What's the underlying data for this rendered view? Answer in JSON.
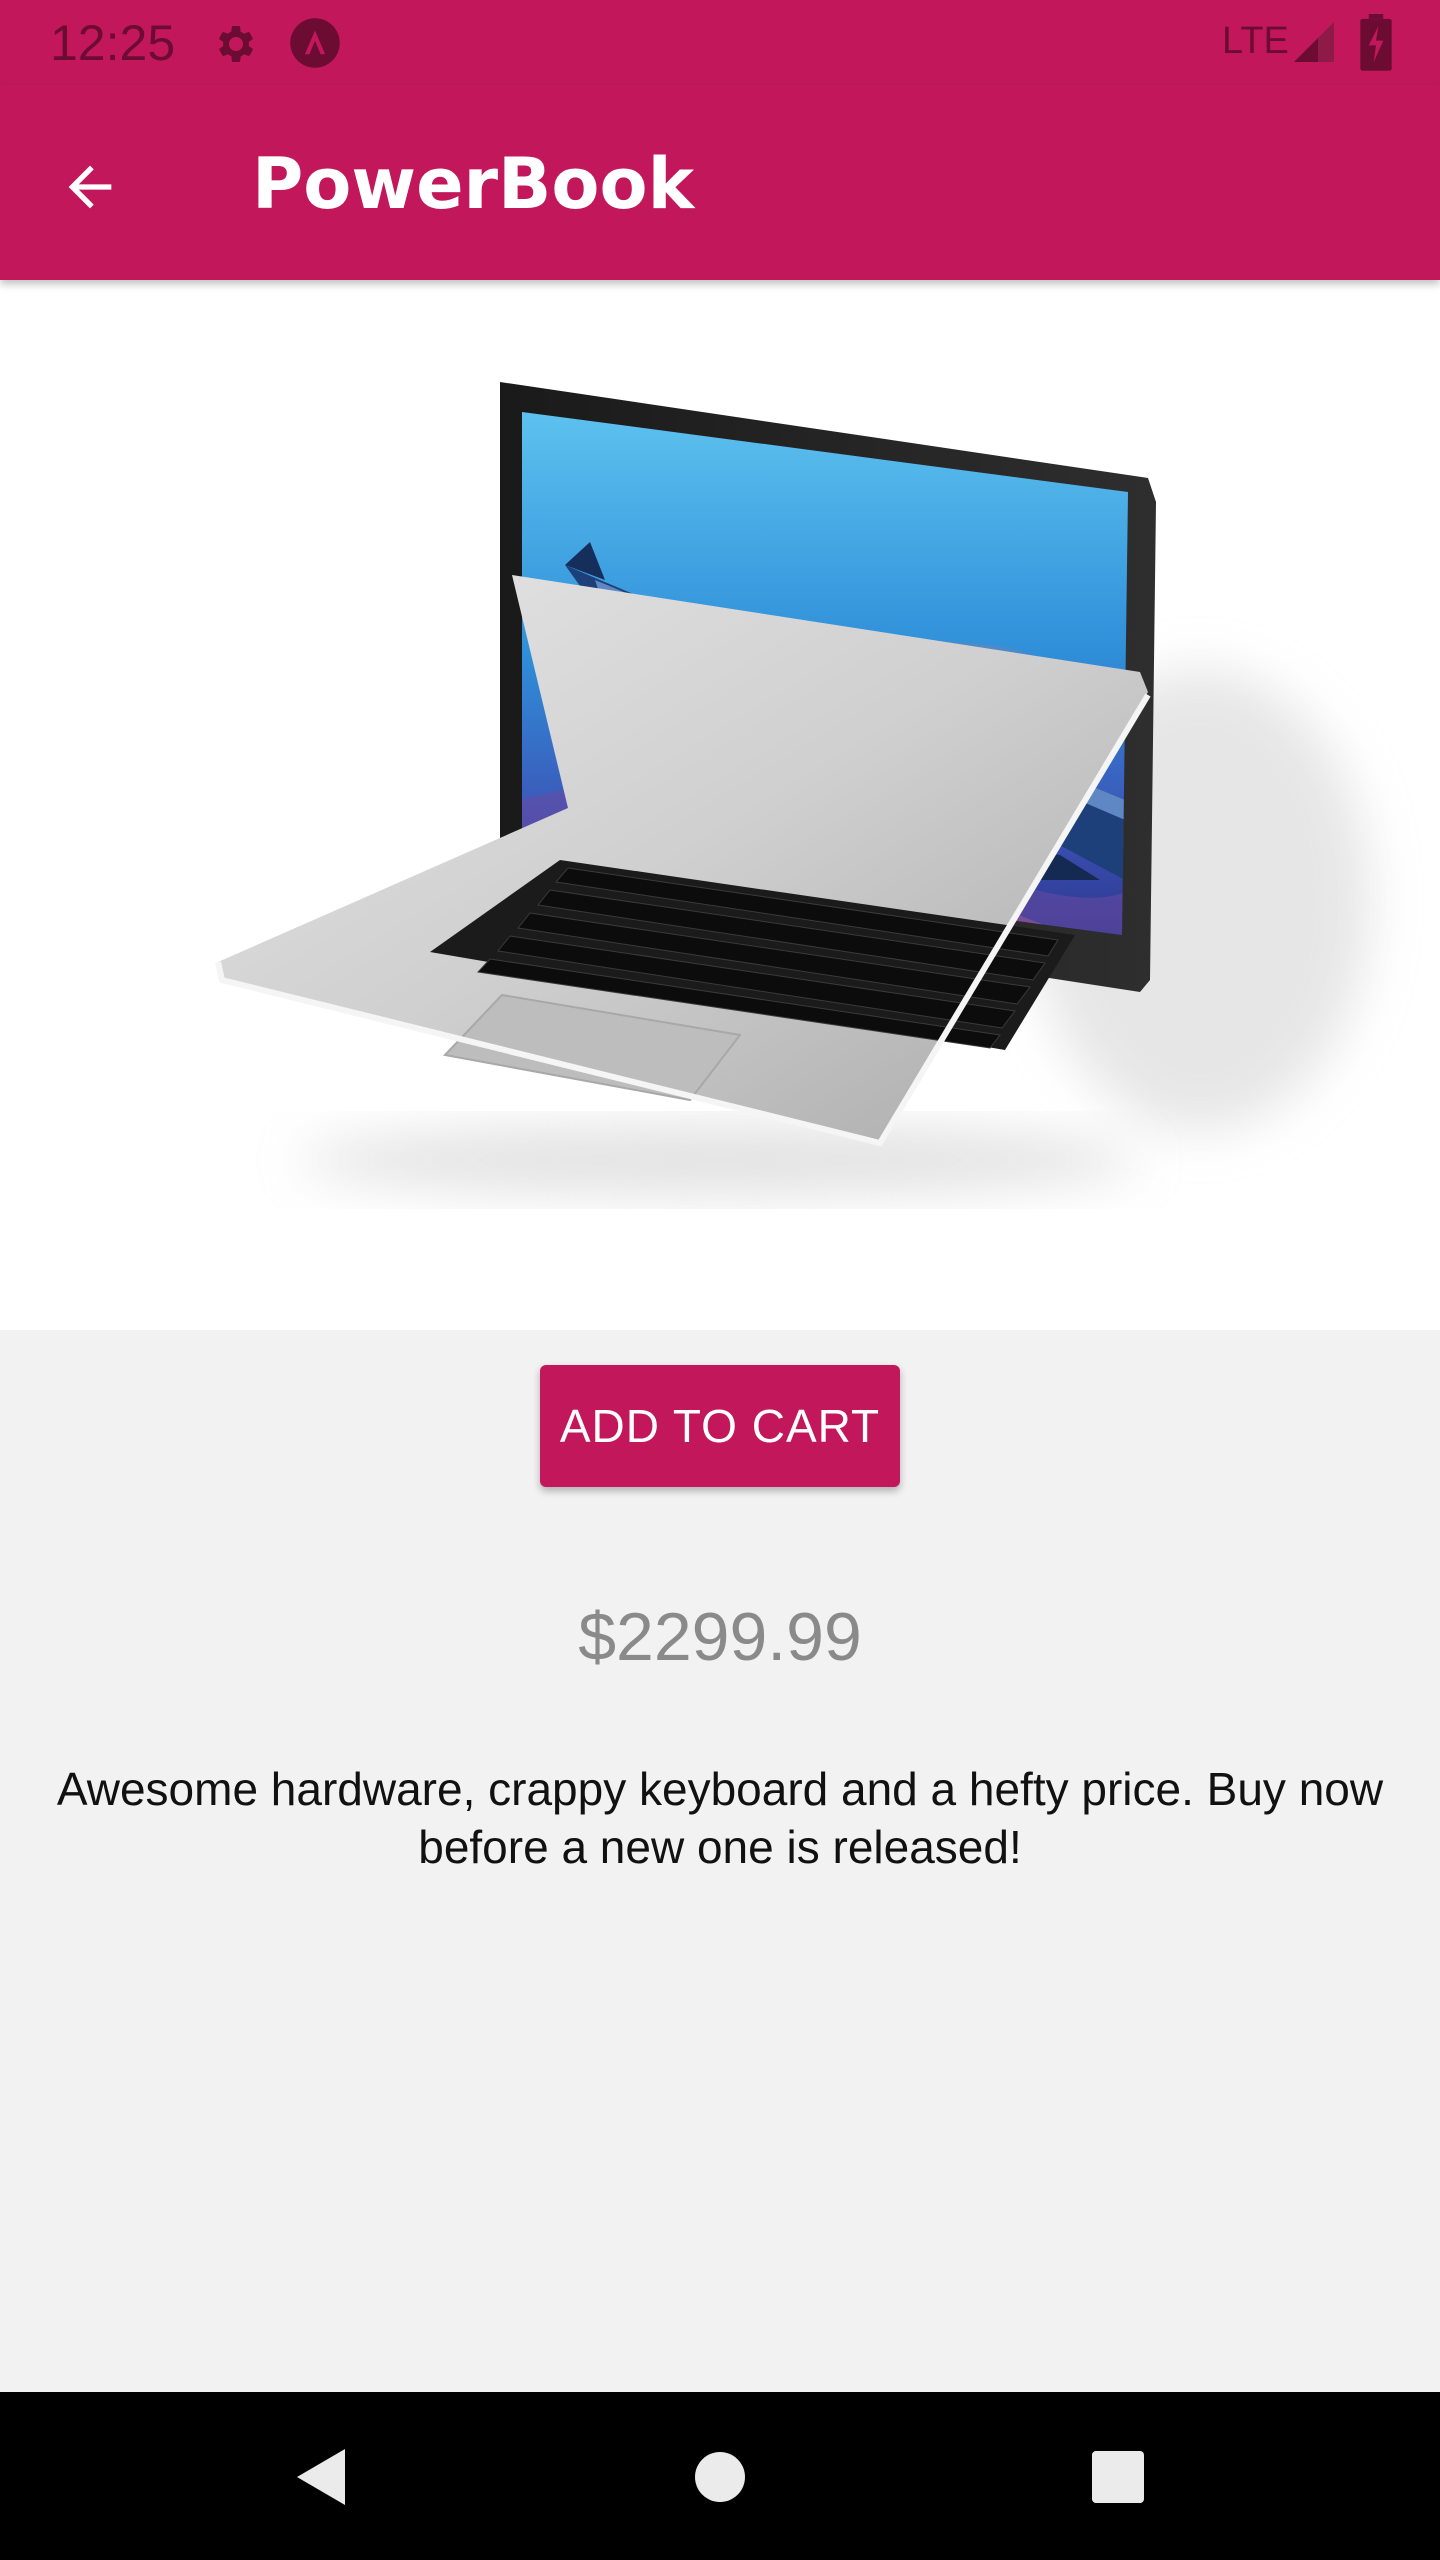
{
  "status_bar": {
    "time": "12:25",
    "network": "LTE",
    "icons": [
      "gear-icon",
      "app-notification-icon",
      "signal-icon",
      "battery-charging-icon"
    ]
  },
  "app_bar": {
    "title": "PowerBook",
    "back_icon": "arrow-back-icon"
  },
  "product": {
    "image": "laptop-product-image",
    "add_to_cart_label": "ADD TO CART",
    "price": "$2299.99",
    "description": "Awesome hardware, crappy keyboard and a hefty price. Buy now before a new one is released!"
  },
  "nav_bar": {
    "icons": [
      "nav-back-icon",
      "nav-home-icon",
      "nav-recents-icon"
    ]
  },
  "colors": {
    "primary": "#c2185b",
    "background": "#f2f2f2",
    "price_text": "#8a8a8a"
  }
}
